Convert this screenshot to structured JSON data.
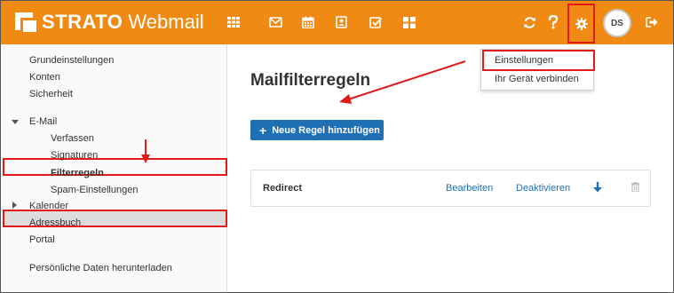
{
  "header": {
    "brand": "STRATO",
    "product": "Webmail",
    "avatar_initials": "DS",
    "background_color": "#f08a12",
    "icons": [
      "apps-grid-icon",
      "mail-icon",
      "calendar-icon",
      "contacts-icon",
      "tasks-icon",
      "widgets-icon",
      "refresh-icon",
      "help-icon",
      "gear-icon",
      "logout-icon"
    ]
  },
  "sidebar": {
    "items": [
      {
        "label": "Grundeinstellungen"
      },
      {
        "label": "Konten"
      },
      {
        "label": "Sicherheit"
      },
      {
        "label": "E-Mail"
      },
      {
        "label": "Verfassen"
      },
      {
        "label": "Signaturen"
      },
      {
        "label": "Filterregeln"
      },
      {
        "label": "Spam-Einstellungen"
      },
      {
        "label": "Kalender"
      },
      {
        "label": "Adressbuch"
      },
      {
        "label": "Portal"
      },
      {
        "label": "Persönliche Daten herunterladen"
      }
    ]
  },
  "main": {
    "title": "Mailfilterregeln",
    "new_rule_label": "Neue Regel hinzufügen",
    "rules": [
      {
        "name": "Redirect",
        "edit_label": "Bearbeiten",
        "toggle_label": "Deaktivieren"
      }
    ]
  },
  "settings_menu": {
    "items": [
      {
        "label": "Einstellungen"
      },
      {
        "label": "Ihr Gerät verbinden"
      }
    ]
  },
  "colors": {
    "accent": "#f08a12",
    "primary_button": "#1f6fb5",
    "link": "#1f6fb5",
    "annotation": "#e21a1a"
  }
}
